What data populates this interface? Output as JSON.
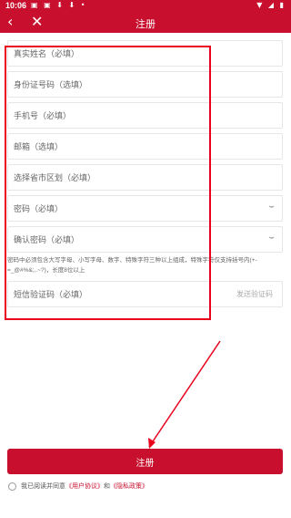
{
  "status": {
    "time": "10:06"
  },
  "nav": {
    "title": "注册",
    "back_icon": "‹",
    "close_icon": "✕"
  },
  "form": {
    "name_placeholder": "真实姓名（必填）",
    "id_placeholder": "身份证号码（选填）",
    "phone_placeholder": "手机号（必填）",
    "email_placeholder": "邮箱（选填）",
    "region_placeholder": "选择省市区划（必填）",
    "password_placeholder": "密码（必填）",
    "confirm_placeholder": "确认密码（必填）",
    "password_hint": "密码中必须包含大写字母、小写字母、数字、特殊字符三种以上组成，特殊字符仅支持括号内(+-=_@#%&;,.~?)，长度8位以上",
    "sms_placeholder": "短信验证码（必填）",
    "sms_button": "发送验证码"
  },
  "submit_label": "注册",
  "agreement": {
    "prefix": "我已阅读并同意",
    "user_agreement": "《用户协议》",
    "and": "和",
    "privacy": "《隐私政策》"
  },
  "colors": {
    "brand": "#c8102e",
    "annotation": "#e8001c"
  }
}
